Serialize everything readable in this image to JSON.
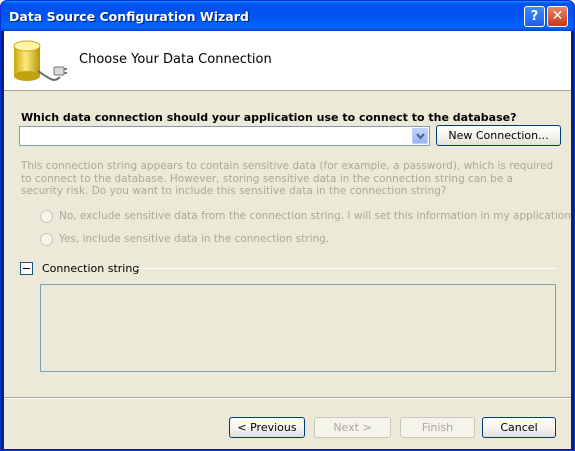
{
  "window": {
    "title": "Data Source Configuration Wizard",
    "help_glyph": "?",
    "close_glyph": "✕"
  },
  "banner": {
    "title": "Choose Your Data Connection",
    "icon": "database-plug-icon"
  },
  "connection": {
    "question": "Which data connection should your application use to connect to the database?",
    "selected_value": "",
    "new_connection_label": "New Connection..."
  },
  "sensitive": {
    "info": "This connection string appears to contain sensitive data (for example, a password), which is required to connect to the database. However, storing sensitive data in the connection string can be a security risk. Do you want to include this sensitive data in the connection string?",
    "option_exclude": "No, exclude sensitive data from the connection string. I will set this information in my application code.",
    "option_include": "Yes, include sensitive data in the connection string."
  },
  "connection_string": {
    "label": "Connection string",
    "value": ""
  },
  "footer": {
    "previous_label": "< Previous",
    "next_label": "Next >",
    "finish_label": "Finish",
    "cancel_label": "Cancel"
  },
  "colors": {
    "titlebar": "#0053ee",
    "dialog_bg": "#ece9d8",
    "disabled_text": "#aca899"
  }
}
